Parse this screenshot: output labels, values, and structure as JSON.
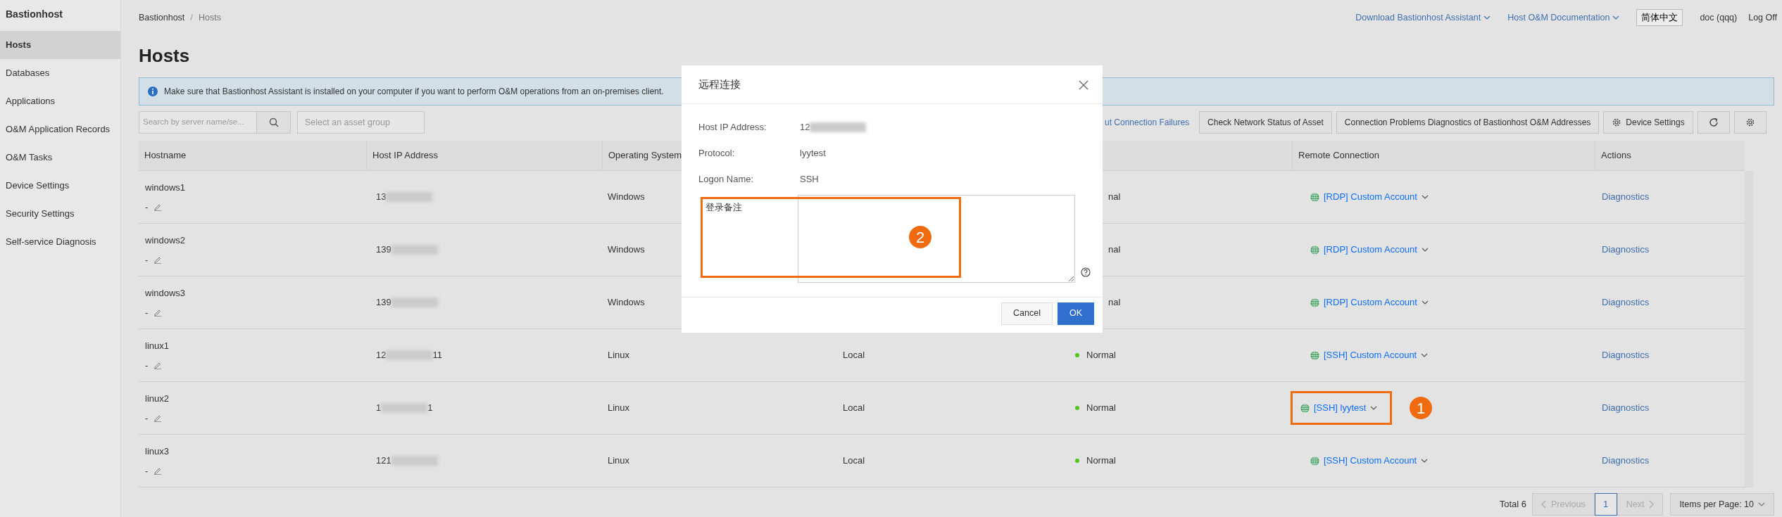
{
  "sidebar": {
    "title": "Bastionhost",
    "items": [
      {
        "label": "Hosts",
        "selected": true
      },
      {
        "label": "Databases",
        "selected": false
      },
      {
        "label": "Applications",
        "selected": false
      },
      {
        "label": "O&M Application Records",
        "selected": false
      },
      {
        "label": "O&M Tasks",
        "selected": false
      },
      {
        "label": "Device Settings",
        "selected": false
      },
      {
        "label": "Security Settings",
        "selected": false
      },
      {
        "label": "Self-service Diagnosis",
        "selected": false
      }
    ]
  },
  "header": {
    "links": [
      "Download Bastionhost Assistant",
      "Host O&M Documentation"
    ],
    "language": "简体中文",
    "user": "doc (qqq)",
    "logout": "Log Off"
  },
  "breadcrumb": [
    "Bastionhost",
    "Hosts"
  ],
  "breadcrumb_separator": "/",
  "page_title": "Hosts",
  "alert": "Make sure that Bastionhost Assistant is installed on your computer if you want to perform O&M operations from an on-premises client.",
  "toolbar": {
    "search_placeholder": "Search by server name/se...",
    "group_placeholder": "Select an asset group",
    "link": "ut Connection Failures",
    "buttons": [
      {
        "kind": "text",
        "label": "Check Network Status of Asset"
      },
      {
        "kind": "text",
        "label": "Connection Problems Diagnostics of Bastionhost O&M Addresses"
      },
      {
        "kind": "gear-text",
        "label": "Device Settings"
      },
      {
        "kind": "refresh"
      },
      {
        "kind": "settings"
      }
    ]
  },
  "table": {
    "columns": [
      "Hostname",
      "Host IP Address",
      "Operating System",
      "Remote Connection",
      "Actions"
    ],
    "rows": [
      {
        "hostname": "windows1",
        "note": "-",
        "ip_prefix": "13",
        "ip_suffix": "",
        "os": "Windows",
        "status": "nal",
        "status_dot": false,
        "remote": "[RDP] Custom Account",
        "highlighted": false,
        "action": "Diagnostics"
      },
      {
        "hostname": "windows2",
        "note": "-",
        "ip_prefix": "139",
        "ip_suffix": "",
        "os": "Windows",
        "status": "nal",
        "status_dot": false,
        "remote": "[RDP] Custom Account",
        "highlighted": false,
        "action": "Diagnostics"
      },
      {
        "hostname": "windows3",
        "note": "-",
        "ip_prefix": "139",
        "ip_suffix": "",
        "os": "Windows",
        "status": "nal",
        "status_dot": false,
        "remote": "[RDP] Custom Account",
        "highlighted": false,
        "action": "Diagnostics"
      },
      {
        "hostname": "linux1",
        "note": "-",
        "ip_prefix": "12",
        "ip_suffix": "11",
        "os": "Linux",
        "network": "Local",
        "status": "Normal",
        "status_dot": true,
        "remote": "[SSH] Custom Account",
        "highlighted": false,
        "action": "Diagnostics"
      },
      {
        "hostname": "linux2",
        "note": "-",
        "ip_prefix": "1",
        "ip_suffix": "1",
        "os": "Linux",
        "network": "Local",
        "status": "Normal",
        "status_dot": true,
        "remote": "[SSH] lyytest",
        "highlighted": true,
        "marker": "1",
        "action": "Diagnostics"
      },
      {
        "hostname": "linux3",
        "note": "-",
        "ip_prefix": "121",
        "ip_suffix": "",
        "os": "Linux",
        "network": "Local",
        "status": "Normal",
        "status_dot": true,
        "remote": "[SSH] Custom Account",
        "highlighted": false,
        "action": "Diagnostics"
      }
    ]
  },
  "pagination": {
    "total": "Total 6",
    "previous": {
      "label": "Previous",
      "disabled": true
    },
    "pages": [
      {
        "label": "1",
        "selected": true
      }
    ],
    "next": {
      "label": "Next",
      "disabled": true
    },
    "page_size": "Items per Page: 10"
  },
  "modal": {
    "title": "远程连接",
    "fields": [
      {
        "label": "Host IP Address:",
        "value": "12",
        "redacted": true
      },
      {
        "label": "Protocol:",
        "value": "lyytest",
        "redacted": false
      },
      {
        "label": "Logon Name:",
        "value": "SSH",
        "redacted": false
      }
    ],
    "note_label": "登录备注",
    "note_highlighted": true,
    "note_marker": "2",
    "buttons": [
      {
        "label": "Cancel",
        "kind": "secondary"
      },
      {
        "label": "OK",
        "kind": "primary"
      }
    ]
  }
}
